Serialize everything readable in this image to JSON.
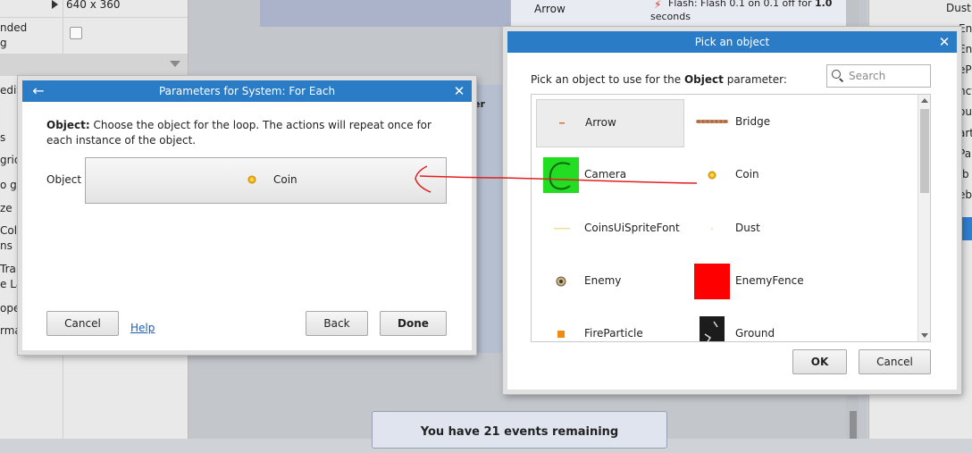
{
  "background": {
    "left_panel": {
      "rows": [
        {
          "key": "",
          "value": "640 x 360"
        },
        {
          "key": "nded",
          "value": ""
        },
        {
          "key": "g",
          "value": ""
        },
        {
          "key": "edit",
          "value": ""
        },
        {
          "key": "s",
          "value": ""
        },
        {
          "key": "grid",
          "value": ""
        },
        {
          "key": "o gr",
          "value": ""
        },
        {
          "key": "ze",
          "value": ""
        },
        {
          "key": "Colli",
          "value": ""
        },
        {
          "key": "ns",
          "value": ""
        },
        {
          "key": "Tran",
          "value": ""
        },
        {
          "key": "e La",
          "value": ""
        },
        {
          "key": "oper",
          "value": ""
        },
        {
          "key": "rma",
          "value": ""
        }
      ]
    },
    "event_sheet": {
      "header_fragment": "er",
      "event_object": "Arrow",
      "event_action_line1": "Flash: Flash 0.1 on 0.1 off for ",
      "event_action_bold": "1.0",
      "event_action_line2": "seconds",
      "events_remaining": "You have 21 events remaining"
    },
    "right_panel": {
      "items": [
        "Dust",
        "Enem",
        "Enem",
        "ePa",
        "nct",
        "our",
        "art",
        "Pa",
        "/b",
        "eba"
      ]
    }
  },
  "params_dialog": {
    "title": "Parameters for System: For Each",
    "desc_bold": "Object:",
    "desc_text": " Choose the object for the loop. The actions will repeat once for each instance of the object.",
    "field_label": "Object",
    "field_value": "Coin",
    "field_icon": "coin-icon",
    "buttons": {
      "cancel": "Cancel",
      "help": "Help",
      "back": "Back",
      "done": "Done"
    }
  },
  "picker_dialog": {
    "title": "Pick an object",
    "prompt_pre": "Pick an object to use for the ",
    "prompt_bold": "Object",
    "prompt_post": " parameter:",
    "search_placeholder": "Search",
    "objects": [
      {
        "name": "Arrow",
        "icon": "arrow-sprite-icon",
        "selected": true
      },
      {
        "name": "Bridge",
        "icon": "bridge-sprite-icon"
      },
      {
        "name": "Camera",
        "icon": "camera-sprite-icon"
      },
      {
        "name": "Coin",
        "icon": "coin-icon"
      },
      {
        "name": "CoinsUiSpriteFont",
        "icon": "spritefont-icon"
      },
      {
        "name": "Dust",
        "icon": "dust-sprite-icon"
      },
      {
        "name": "Enemy",
        "icon": "enemy-sprite-icon"
      },
      {
        "name": "EnemyFence",
        "icon": "enemyfence-sprite-icon"
      },
      {
        "name": "FireParticle",
        "icon": "fireparticle-icon"
      },
      {
        "name": "Ground",
        "icon": "ground-tile-icon"
      }
    ],
    "buttons": {
      "ok": "OK",
      "cancel": "Cancel"
    }
  },
  "colors": {
    "title_bar": "#2a7cc7",
    "annotation": "#e02020",
    "camera_green": "#22dd22",
    "enemyfence_red": "#ff0000"
  }
}
